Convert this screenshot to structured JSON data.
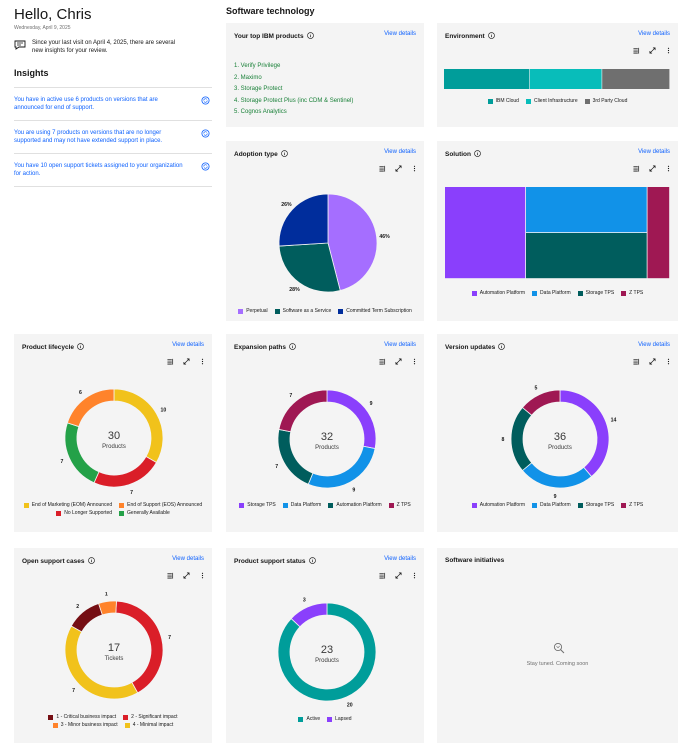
{
  "greeting": "Hello, Chris",
  "date": "Wednesday, April 9, 2025",
  "last_visit": "Since your last visit on April 4, 2025, there are several new insights for your review.",
  "insights": {
    "title": "Insights",
    "items": [
      {
        "text": "You have in active use 6 products on versions that are announced for end of support."
      },
      {
        "text": "You are using 7 products on versions that are no longer supported and may not have extended support in place."
      },
      {
        "text": "You have 10 open support tickets assigned to your organization for action."
      }
    ]
  },
  "section_title": "Software technology",
  "view_details": "View details",
  "tiles": {
    "top_products": {
      "title": "Your top IBM products",
      "items": [
        "1. Verify Privilege",
        "2. Maximo",
        "3. Storage Protect",
        "4. Storage Protect Plus (inc CDM & Sentinel)",
        "5. Cognos Analytics"
      ]
    },
    "environment": {
      "title": "Environment",
      "legend": [
        {
          "label": "IBM Cloud",
          "color": "#009d9a"
        },
        {
          "label": "Client Infrastructure",
          "color": "#08bdba"
        },
        {
          "label": "3rd Party Cloud",
          "color": "#6f6f6f"
        }
      ]
    },
    "adoption": {
      "title": "Adoption type",
      "legend": [
        {
          "label": "Perpetual",
          "color": "#a56eff"
        },
        {
          "label": "Software as a Service",
          "color": "#005d5d"
        },
        {
          "label": "Committed Term Subscription",
          "color": "#002d9c"
        }
      ]
    },
    "solution": {
      "title": "Solution",
      "legend": [
        {
          "label": "Automation Platform",
          "color": "#8a3ffc"
        },
        {
          "label": "Data Platform",
          "color": "#1192e8"
        },
        {
          "label": "Storage TPS",
          "color": "#005d5d"
        },
        {
          "label": "Z TPS",
          "color": "#9f1853"
        }
      ]
    },
    "lifecycle": {
      "title": "Product lifecycle",
      "center_value": "30",
      "center_label": "Products",
      "legend": [
        {
          "label": "End of Marketing (EOM) Announced",
          "color": "#f1c21b"
        },
        {
          "label": "End of Support (EOS) Announced",
          "color": "#ff832b"
        },
        {
          "label": "No Longer Supported",
          "color": "#da1e28"
        },
        {
          "label": "Generally Available",
          "color": "#24a148"
        }
      ]
    },
    "expansion": {
      "title": "Expansion paths",
      "center_value": "32",
      "center_label": "Products",
      "legend": [
        {
          "label": "Storage TPS",
          "color": "#8a3ffc"
        },
        {
          "label": "Data Platform",
          "color": "#1192e8"
        },
        {
          "label": "Automation Platform",
          "color": "#005d5d"
        },
        {
          "label": "Z TPS",
          "color": "#9f1853"
        }
      ]
    },
    "version": {
      "title": "Version updates",
      "center_value": "36",
      "center_label": "Products",
      "legend": [
        {
          "label": "Automation Platform",
          "color": "#8a3ffc"
        },
        {
          "label": "Data Platform",
          "color": "#1192e8"
        },
        {
          "label": "Storage TPS",
          "color": "#005d5d"
        },
        {
          "label": "Z TPS",
          "color": "#9f1853"
        }
      ]
    },
    "support_cases": {
      "title": "Open support cases",
      "center_value": "17",
      "center_label": "Tickets",
      "legend": [
        {
          "label": "1 - Critical business impact",
          "color": "#750e13"
        },
        {
          "label": "2 - Significant impact",
          "color": "#da1e28"
        },
        {
          "label": "3 - Minor business impact",
          "color": "#ff832b"
        },
        {
          "label": "4 - Minimal impact",
          "color": "#f1c21b"
        }
      ]
    },
    "support_status": {
      "title": "Product support status",
      "center_value": "23",
      "center_label": "Products",
      "legend": [
        {
          "label": "Active",
          "color": "#009d9a"
        },
        {
          "label": "Lapsed",
          "color": "#8a3ffc"
        }
      ]
    },
    "initiatives": {
      "title": "Software initiatives",
      "message": "Stay tuned. Coming soon"
    }
  },
  "chart_data": [
    {
      "id": "environment",
      "type": "bar",
      "orientation": "horizontal-stacked",
      "categories": [
        "IBM Cloud",
        "Client Infrastructure",
        "3rd Party Cloud"
      ],
      "values": [
        38,
        32,
        30
      ]
    },
    {
      "id": "adoption",
      "type": "pie",
      "categories": [
        "Perpetual",
        "Software as a Service",
        "Committed Term Subscription"
      ],
      "values": [
        46,
        28,
        26
      ],
      "labels": [
        "46%",
        "28%",
        "26%"
      ]
    },
    {
      "id": "solution",
      "type": "treemap",
      "categories": [
        "Automation Platform",
        "Data Platform",
        "Storage TPS",
        "Z TPS"
      ],
      "values": [
        36,
        27,
        27,
        10
      ]
    },
    {
      "id": "lifecycle",
      "type": "pie",
      "categories": [
        "End of Marketing (EOM) Announced",
        "No Longer Supported",
        "Generally Available",
        "End of Support (EOS) Announced"
      ],
      "values": [
        10,
        7,
        7,
        6
      ]
    },
    {
      "id": "expansion",
      "type": "pie",
      "categories": [
        "Storage TPS",
        "Data Platform",
        "Automation Platform",
        "Z TPS"
      ],
      "values": [
        9,
        9,
        7,
        7
      ]
    },
    {
      "id": "version",
      "type": "pie",
      "categories": [
        "Automation Platform",
        "Data Platform",
        "Storage TPS",
        "Z TPS"
      ],
      "values": [
        14,
        9,
        8,
        5
      ]
    },
    {
      "id": "support_cases",
      "type": "pie",
      "categories": [
        "2 - Significant impact",
        "4 - Minimal impact",
        "1 - Critical business impact",
        "3 - Minor business impact"
      ],
      "values": [
        7,
        7,
        2,
        1
      ]
    },
    {
      "id": "support_status",
      "type": "pie",
      "categories": [
        "Active",
        "Lapsed"
      ],
      "values": [
        20,
        3
      ]
    }
  ]
}
